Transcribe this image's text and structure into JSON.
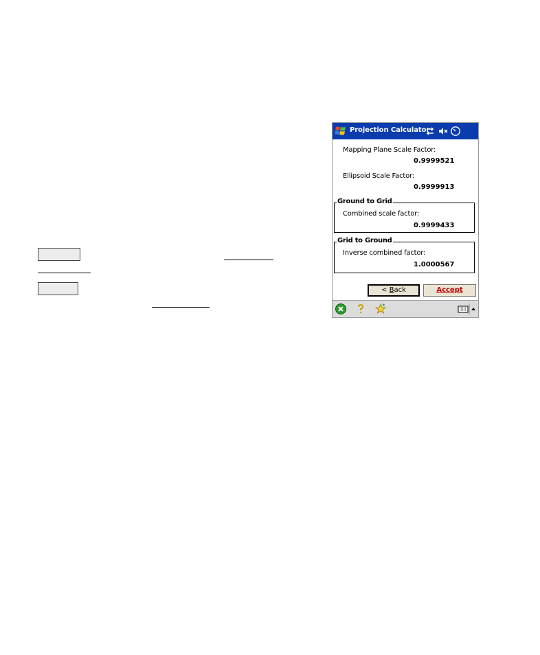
{
  "window": {
    "title": "Projection Calculator",
    "icons": [
      "windows-start-icon",
      "connectivity-icon",
      "speaker-muted-icon",
      "clock-icon"
    ]
  },
  "fields": {
    "mapping_plane_label": "Mapping Plane Scale Factor:",
    "mapping_plane_value": "0.9999521",
    "ellipsoid_label": "Ellipsoid Scale Factor:",
    "ellipsoid_value": "0.9999913"
  },
  "groups": {
    "ground_to_grid": {
      "title": "Ground to Grid",
      "label": "Combined scale factor:",
      "value": "0.9999433"
    },
    "grid_to_ground": {
      "title": "Grid to Ground",
      "label": "Inverse combined factor:",
      "value": "1.0000567"
    }
  },
  "buttons": {
    "back_prefix": "< ",
    "back_hotkey": "B",
    "back_rest": "ack",
    "accept_label": "Accept"
  },
  "menubar": {
    "icons": [
      "close-icon",
      "help-icon",
      "favorites-icon",
      "keyboard-icon",
      "menu-arrow-icon"
    ]
  },
  "colors": {
    "titlebar": "#0a3cae",
    "accept_text": "#c00000",
    "button_face": "#e9e4d4",
    "menubar": "#dcdcdc"
  }
}
